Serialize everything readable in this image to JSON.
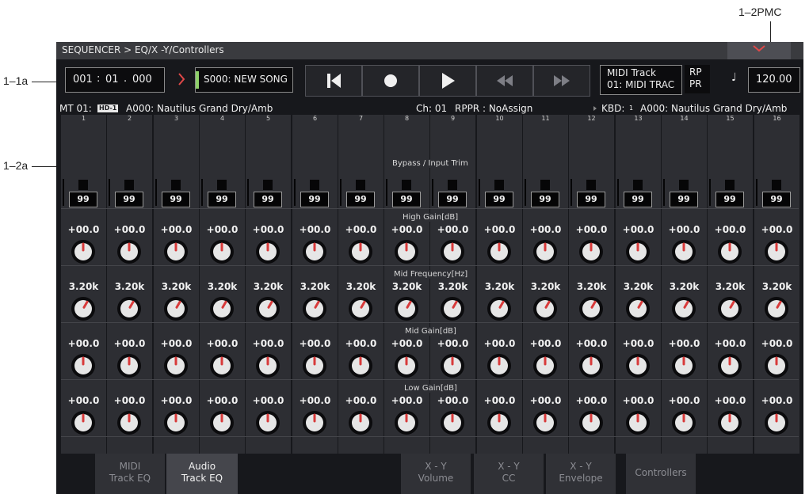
{
  "callouts": {
    "top_right": "1–2PMC",
    "left_a": "1–1a",
    "left_b": "1–2a"
  },
  "header": {
    "title": "SEQUENCER > EQ/X -Y/Controllers"
  },
  "transport": {
    "location": [
      "001",
      "01",
      "000"
    ],
    "song": "S000: NEW SONG",
    "midi_track_label": "MIDI Track",
    "midi_track_value": "01: MIDI TRAC",
    "rp": "RP",
    "pr": "PR",
    "tempo_symbol": "♩",
    "tempo": "120.00"
  },
  "info_bar": {
    "mt": "MT 01:",
    "hd_badge": "HD-1",
    "program": "A000: Nautilus Grand Dry/Amb",
    "ch": "Ch: 01",
    "rppr": "RPPR : NoAssign",
    "kbd_label": "KBD:",
    "kbd_num": "1",
    "kbd_program": "A000: Nautilus Grand Dry/Amb"
  },
  "columns": [
    "1",
    "2",
    "3",
    "4",
    "5",
    "6",
    "7",
    "8",
    "9",
    "10",
    "11",
    "12",
    "13",
    "14",
    "15",
    "16"
  ],
  "sections": {
    "bypass": "Bypass / Input Trim",
    "high": "High Gain[dB]",
    "midfreq": "Mid Frequency[Hz]",
    "midgain": "Mid Gain[dB]",
    "low": "Low Gain[dB]"
  },
  "values": {
    "trim": "99",
    "high_gain": "+00.0",
    "mid_freq": "3.20k",
    "mid_gain": "+00.0",
    "low_gain": "+00.0"
  },
  "tabs": [
    {
      "line1": "MIDI",
      "line2": "Track EQ",
      "active": false
    },
    {
      "line1": "Audio",
      "line2": "Track EQ",
      "active": true
    },
    {
      "line1": "X - Y",
      "line2": "Volume",
      "active": false
    },
    {
      "line1": "X - Y",
      "line2": "CC",
      "active": false
    },
    {
      "line1": "X - Y",
      "line2": "Envelope",
      "active": false
    },
    {
      "line1": "Controllers",
      "line2": "",
      "active": false
    }
  ],
  "colors": {
    "screen_bg": "#17181c",
    "cell_bg": "#2d2e33",
    "accent_red": "#d83a3a",
    "song_marker": "#8fd16a"
  }
}
